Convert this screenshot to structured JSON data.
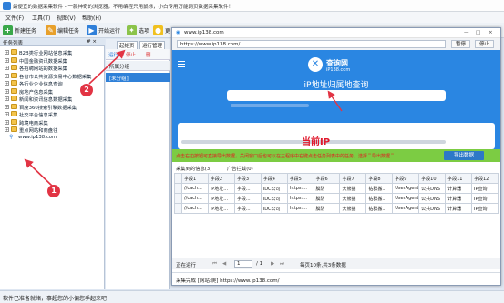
{
  "app": {
    "title": "最便宜的数据采集软件 - 一款神奇的浏览器，不用编程只用鼠标，小白专用万能网页数据采集软件！",
    "menu": [
      "文件(F)",
      "工具(T)",
      "视图(V)",
      "帮助(H)"
    ]
  },
  "toolbar": {
    "new_task": "新建任务",
    "edit_task": "编辑任务",
    "run": "开始运行",
    "options": "选项",
    "more": "更"
  },
  "left_panel": {
    "header": "任务列表",
    "header_controls": "# ×",
    "items": [
      {
        "label": "B2B类行业网站信息采集",
        "type": "folder"
      },
      {
        "label": "中国金融资讯数据采集",
        "type": "folder"
      },
      {
        "label": "各招聘网站的数据采集",
        "type": "folder"
      },
      {
        "label": "各省市公共资源交易中心数据采集",
        "type": "folder"
      },
      {
        "label": "各行业企业信息查询",
        "type": "folder"
      },
      {
        "label": "房地产信息采集",
        "type": "folder"
      },
      {
        "label": "新闻和资讯信息数据采集",
        "type": "folder"
      },
      {
        "label": "百度360搜索引擎数据采集",
        "type": "folder"
      },
      {
        "label": "社交平台信息采集",
        "type": "folder"
      },
      {
        "label": "跨境电商采集",
        "type": "folder"
      },
      {
        "label": "重点网站和商盘往",
        "type": "folder"
      },
      {
        "label": "www.ip138.com",
        "type": "task"
      }
    ]
  },
  "mid_panel": {
    "tabs": [
      "起始页",
      "运行管理"
    ],
    "tools": [
      "运行",
      "停止",
      "删"
    ],
    "group_header": "所属分组",
    "selected_row": "[未分组]"
  },
  "popup": {
    "title": "www.ip138.com",
    "window_buttons": [
      "—",
      "□",
      "×"
    ],
    "url": "https://www.ip138.com/",
    "pause": "暂停",
    "stop": "停止",
    "site": {
      "logo_char": "✕",
      "logo_text": "查询网",
      "logo_sub": "iP138.com",
      "heading": "iP地址归属地查询"
    },
    "annotation_ip": "当前IP",
    "banner_text": "点击右边按钮可直接导出数据，关闭窗口后也可以在主程序中右键点击任务列表中的任务，选择＂导出数据＂",
    "export_button": "导出数据",
    "data_tabs": [
      "采集到的信息(3)",
      "广告拦截(0)"
    ],
    "columns": [
      "字段1",
      "字段2",
      "字段3",
      "字段4",
      "字段5",
      "字段6",
      "字段7",
      "字段8",
      "字段9",
      "字段10",
      "字段11",
      "字段12"
    ],
    "rows": [
      [
        "//cach...",
        "iP地址...",
        "字段...",
        "IDC公司",
        "https:...",
        "膜防",
        "大熊猫",
        "钻群搬...",
        "UserAgent",
        "公共DNS",
        "计算器",
        "IP查询"
      ],
      [
        "//cach...",
        "iP地址...",
        "字段...",
        "IDC公司",
        "https:...",
        "膜防",
        "大熊猫",
        "钻群搬...",
        "UserAgent",
        "公共DNS",
        "计算器",
        "IP查询"
      ],
      [
        "//cach...",
        "iP地址...",
        "字段...",
        "IDC公司",
        "https:...",
        "膜防",
        "大熊猫",
        "钻群搬...",
        "UserAgent",
        "公共DNS",
        "计算器",
        "IP查询"
      ]
    ],
    "pager": {
      "status": "正在运行",
      "page": "1",
      "of": "/ 1",
      "summary": "每页10条,共3条数据"
    },
    "status_text": "采集完成 [网站:爬] https://www.ip138.com/"
  },
  "statusbar": "软件已准备就绪，事超您的小偏您手起来吧！",
  "annotations": {
    "badge1": "1",
    "badge2": "2"
  },
  "colors": {
    "accent": "#2a86e2",
    "banner": "#7ccc43",
    "annotation": "#e23444"
  }
}
